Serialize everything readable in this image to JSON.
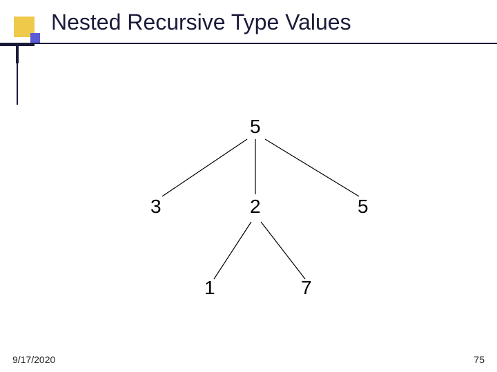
{
  "title": "Nested Recursive Type Values",
  "chart_data": {
    "type": "tree",
    "title": "Nested Recursive Type Values",
    "root": {
      "value": 5,
      "children": [
        {
          "value": 3,
          "children": []
        },
        {
          "value": 2,
          "children": [
            {
              "value": 1,
              "children": []
            },
            {
              "value": 7,
              "children": []
            }
          ]
        },
        {
          "value": 5,
          "children": []
        }
      ]
    }
  },
  "nodes": {
    "root": "5",
    "l": "3",
    "m": "2",
    "r": "5",
    "ml": "1",
    "mr": "7"
  },
  "footer": {
    "date": "9/17/2020",
    "page": "75"
  }
}
